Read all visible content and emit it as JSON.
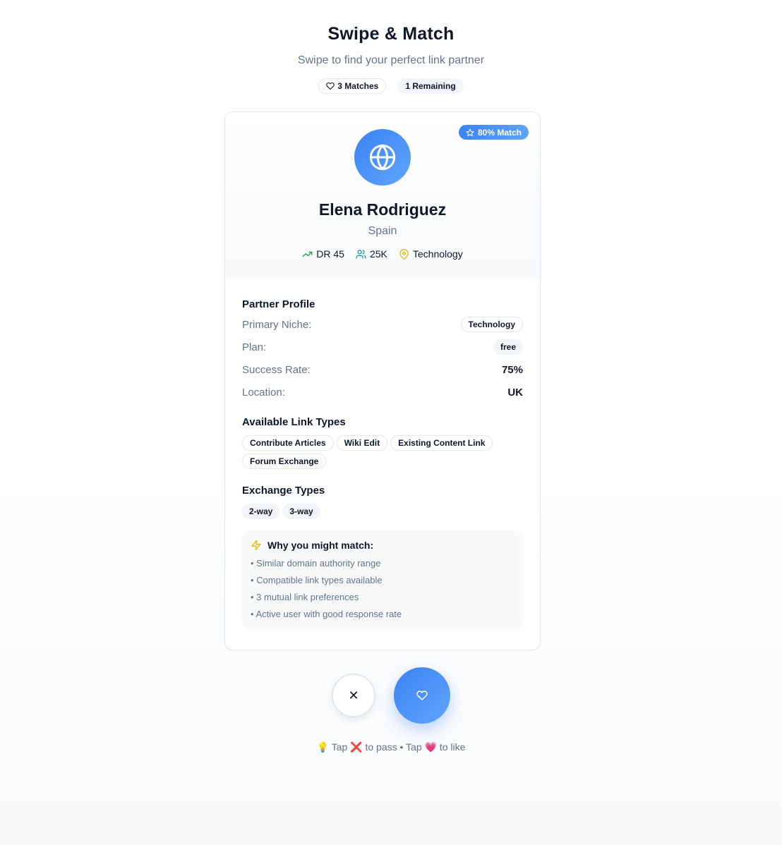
{
  "header": {
    "title": "Swipe & Match",
    "subtitle": "Swipe to find your perfect link partner",
    "matches_label": "3 Matches",
    "remaining_label": "1 Remaining"
  },
  "profile": {
    "match_badge": "80% Match",
    "avatar_icon": "globe-icon",
    "name": "Elena Rodriguez",
    "country": "Spain",
    "stats": {
      "dr": "DR 45",
      "traffic": "25K",
      "niche": "Technology"
    }
  },
  "partner_profile": {
    "title": "Partner Profile",
    "rows": [
      {
        "label": "Primary Niche:",
        "value": "Technology"
      },
      {
        "label": "Plan:",
        "value": "free"
      },
      {
        "label": "Success Rate:",
        "value": "75%"
      },
      {
        "label": "Location:",
        "value": "UK"
      }
    ]
  },
  "link_types": {
    "title": "Available Link Types",
    "items": [
      "Contribute Articles",
      "Wiki Edit",
      "Existing Content Link",
      "Forum Exchange"
    ]
  },
  "exchange_types": {
    "title": "Exchange Types",
    "items": [
      "2-way",
      "3-way"
    ]
  },
  "why_match": {
    "title": "Why you might match:",
    "reasons": [
      "• Similar domain authority range",
      "• Compatible link types available",
      "• 3 mutual link preferences",
      "• Active user with good response rate"
    ]
  },
  "actions": {
    "pass_symbol": "✕",
    "hint": "💡 Tap ❌ to pass • Tap 💗 to like"
  },
  "colors": {
    "accent": "#3b82f6",
    "accent_light": "#60a5fa",
    "muted": "#64748b",
    "dr_green": "#16a34a",
    "users_teal": "#0891b2",
    "niche_yellow": "#eab308"
  }
}
